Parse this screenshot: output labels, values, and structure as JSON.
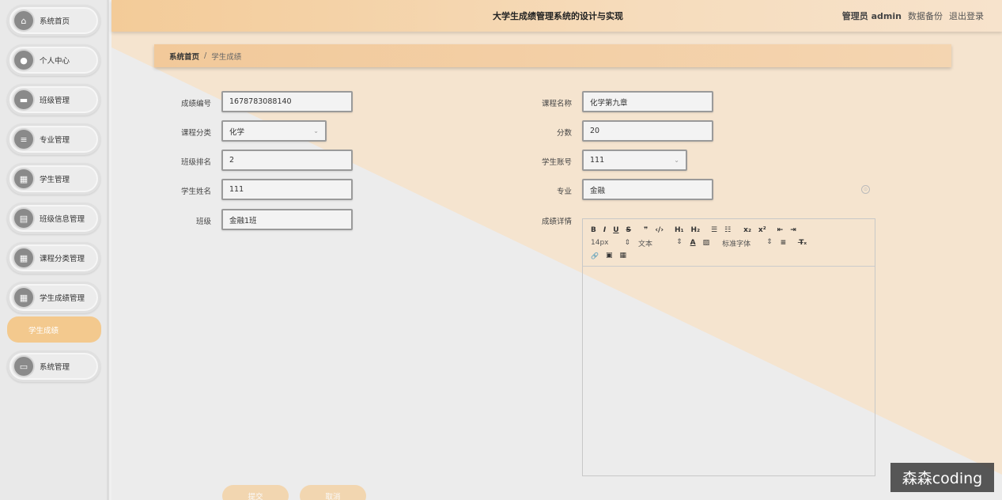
{
  "app": {
    "title": "大学生成绩管理系统的设计与实现",
    "user": "管理员 admin",
    "backup_label": "数据备份",
    "logout_label": "退出登录"
  },
  "sidebar": {
    "items": [
      {
        "label": "系统首页",
        "icon": "home-icon",
        "glyph": "⌂"
      },
      {
        "label": "个人中心",
        "icon": "user-icon",
        "glyph": "●"
      },
      {
        "label": "班级管理",
        "icon": "chat-icon",
        "glyph": "▬"
      },
      {
        "label": "专业管理",
        "icon": "list-icon",
        "glyph": "≡"
      },
      {
        "label": "学生管理",
        "icon": "grid-icon",
        "glyph": "▦"
      },
      {
        "label": "班级信息管理",
        "icon": "document-icon",
        "glyph": "▤"
      },
      {
        "label": "课程分类管理",
        "icon": "grid-icon",
        "glyph": "▦"
      },
      {
        "label": "学生成绩管理",
        "icon": "grid-icon",
        "glyph": "▦"
      }
    ],
    "sub_item": "学生成绩",
    "last_item": {
      "label": "系统管理",
      "icon": "monitor-icon",
      "glyph": "▭"
    }
  },
  "breadcrumb": {
    "home": "系统首页",
    "sep": "/",
    "current": "学生成绩"
  },
  "form": {
    "score_no": {
      "label": "成绩编号",
      "value": "1678783088140"
    },
    "course_category": {
      "label": "课程分类",
      "value": "化学"
    },
    "class_rank": {
      "label": "班级排名",
      "value": "2"
    },
    "student_name": {
      "label": "学生姓名",
      "value": "111"
    },
    "class": {
      "label": "班级",
      "value": "金融1班"
    },
    "course_name": {
      "label": "课程名称",
      "value": "化学第九章"
    },
    "score": {
      "label": "分数",
      "value": "20"
    },
    "student_account": {
      "label": "学生账号",
      "value": "111"
    },
    "major": {
      "label": "专业",
      "value": "金融"
    },
    "detail": {
      "label": "成绩详情"
    }
  },
  "editor": {
    "row1": [
      "B",
      "I",
      "U",
      "S",
      "❞",
      "‹/›",
      "H₁",
      "H₂",
      "☰",
      "☷",
      "x₂",
      "x²",
      "⇤",
      "⇥"
    ],
    "font_size": "14px",
    "text_type": "文本",
    "font_family": "标准字体",
    "row2_icons": [
      "A",
      "▨",
      "≡",
      "T̶ₓ"
    ],
    "row3": [
      "🔗",
      "▣",
      "▦"
    ]
  },
  "buttons": {
    "submit": "提交",
    "cancel": "取消"
  },
  "watermark": "森森coding"
}
